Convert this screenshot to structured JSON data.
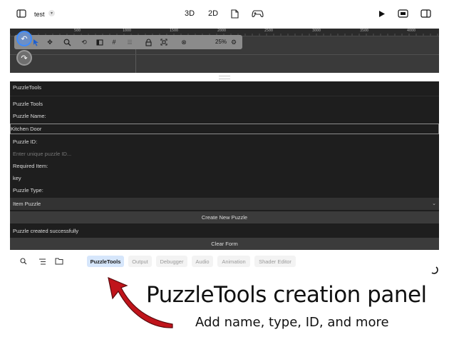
{
  "header": {
    "project_name": "test",
    "modes": [
      "3D",
      "2D"
    ],
    "icons": [
      "sidebar-toggle-icon",
      "chevron-down-icon",
      "document-icon",
      "gamepad-icon",
      "play-icon",
      "export-icon",
      "right-panel-icon"
    ]
  },
  "viewport": {
    "ruler_ticks": [
      "500",
      "1000",
      "1500",
      "2000",
      "2500",
      "3000",
      "3500",
      "4000"
    ],
    "zoom_label": "25%",
    "tools": [
      "select-arrow-icon",
      "move-icon",
      "zoom-icon",
      "link-icon",
      "rect-icon",
      "grid-icon",
      "snap-icon",
      "lock-icon",
      "frame-icon",
      "settings-icon"
    ],
    "undo_icon": "undo-icon",
    "redo_icon": "redo-icon",
    "undo_color": "#3d8bfd"
  },
  "panel": {
    "tab_title": "PuzzleTools",
    "section_title": "Puzzle Tools",
    "name_label": "Puzzle Name:",
    "name_value": "Kitchen Door",
    "id_label": "Puzzle ID:",
    "id_placeholder": "Enter unique puzzle ID...",
    "required_label": "Required Item:",
    "required_value": "key",
    "type_label": "Puzzle Type:",
    "type_value": "Item Puzzle",
    "create_button": "Create New Puzzle",
    "status_message": "Puzzle created successfully",
    "clear_button": "Clear Form"
  },
  "bottom_tabs": {
    "icons": [
      "search-icon",
      "list-icon",
      "folder-icon"
    ],
    "tabs": [
      "PuzzleTools",
      "Output",
      "Debugger",
      "Audio",
      "Animation",
      "Shader Editor"
    ],
    "active": "PuzzleTools",
    "active_color": "#d6e6fb"
  },
  "annotation": {
    "title": "PuzzleTools creation panel",
    "subtitle": "Add name, type, ID, and more",
    "arrow_color": "#c0141b"
  }
}
